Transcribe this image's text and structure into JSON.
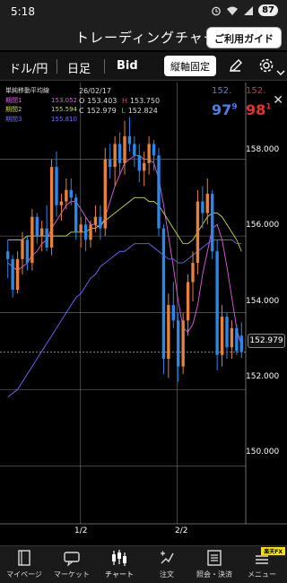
{
  "status": {
    "time": "5:18",
    "battery": "87"
  },
  "header": {
    "title": "トレーディングチャー",
    "guide_button": "ご利用ガイド"
  },
  "toolbar": {
    "pair": "ドル/円",
    "timeframe": "日足",
    "side": "Bid",
    "fix_axis": "縦軸固定",
    "icons": [
      "pencil-icon",
      "gear-icon",
      "chevron-down-icon"
    ]
  },
  "legend": {
    "title": "単純移動平均線",
    "periods": [
      {
        "label": "期間1",
        "value": "153.052",
        "color": "#e060e0"
      },
      {
        "label": "期間2",
        "value": "155.594",
        "color": "#c8d84a"
      },
      {
        "label": "期間3",
        "value": "155.810",
        "color": "#6a6aff"
      }
    ]
  },
  "ohlc": {
    "date": "26/02/17",
    "o_label": "O",
    "o": "153.403",
    "h_label": "H",
    "h": "153.750",
    "c_label": "C",
    "c": "152.979",
    "l_label": "L",
    "l": "152.824"
  },
  "quote": {
    "bid_head": "152.",
    "bid_main": "97",
    "bid_sup": "9",
    "ask_head": "152.",
    "ask_main": "98",
    "ask_sup": "1"
  },
  "axis": {
    "yticks": [
      "158.000",
      "156.000",
      "154.000",
      "152.000",
      "150.000"
    ],
    "current_price": "152.979",
    "xticks": [
      "1/2",
      "2/2"
    ]
  },
  "nav": [
    {
      "label": "マイページ",
      "icon": "book-icon"
    },
    {
      "label": "マーケット",
      "icon": "chat-icon"
    },
    {
      "label": "チャート",
      "icon": "candlestick-icon"
    },
    {
      "label": "注文",
      "icon": "order-icon"
    },
    {
      "label": "照会・決済",
      "icon": "list-icon"
    },
    {
      "label": "メニュー",
      "icon": "menu-icon"
    }
  ],
  "badge": "楽天FX",
  "chart_data": {
    "type": "candlestick",
    "pair": "USD/JPY",
    "ylim": [
      148.5,
      160.0
    ],
    "yticks": [
      158.0,
      156.0,
      154.0,
      152.0,
      150.0
    ],
    "xticks": [
      "1/2",
      "2/2"
    ],
    "candles": [
      [
        155.6,
        155.9,
        154.9,
        155.4
      ],
      [
        155.4,
        155.5,
        154.4,
        154.6
      ],
      [
        154.6,
        155.6,
        154.5,
        155.4
      ],
      [
        155.4,
        156.1,
        155.0,
        155.9
      ],
      [
        155.9,
        156.0,
        155.1,
        155.3
      ],
      [
        155.3,
        156.7,
        155.1,
        156.5
      ],
      [
        156.5,
        156.6,
        155.8,
        156.0
      ],
      [
        156.0,
        156.4,
        155.6,
        156.2
      ],
      [
        156.2,
        156.8,
        155.6,
        155.7
      ],
      [
        155.7,
        158.0,
        155.5,
        157.8
      ],
      [
        157.8,
        158.2,
        156.5,
        156.8
      ],
      [
        156.8,
        157.1,
        156.4,
        156.9
      ],
      [
        156.9,
        157.5,
        156.7,
        157.2
      ],
      [
        157.2,
        157.5,
        156.8,
        157.0
      ],
      [
        157.0,
        157.1,
        155.9,
        156.1
      ],
      [
        156.1,
        156.5,
        155.7,
        156.3
      ],
      [
        156.3,
        156.5,
        155.6,
        155.9
      ],
      [
        155.9,
        156.4,
        155.7,
        156.3
      ],
      [
        156.3,
        156.8,
        156.1,
        156.5
      ],
      [
        156.5,
        156.8,
        155.9,
        156.2
      ],
      [
        156.2,
        158.3,
        156.0,
        158.0
      ],
      [
        158.0,
        158.4,
        157.5,
        157.8
      ],
      [
        157.8,
        158.6,
        157.3,
        158.4
      ],
      [
        158.4,
        158.7,
        157.6,
        157.9
      ],
      [
        157.9,
        159.0,
        157.6,
        158.6
      ],
      [
        158.6,
        159.1,
        158.2,
        158.4
      ],
      [
        158.4,
        158.6,
        157.8,
        158.1
      ],
      [
        158.1,
        158.4,
        157.4,
        157.7
      ],
      [
        157.7,
        158.2,
        157.3,
        157.9
      ],
      [
        157.9,
        158.6,
        157.6,
        158.4
      ],
      [
        158.4,
        158.5,
        157.7,
        158.1
      ],
      [
        158.1,
        158.3,
        156.0,
        156.2
      ],
      [
        156.2,
        156.3,
        152.4,
        152.8
      ],
      [
        152.8,
        154.5,
        152.3,
        154.2
      ],
      [
        154.2,
        154.8,
        153.6,
        153.8
      ],
      [
        153.8,
        154.0,
        152.2,
        152.6
      ],
      [
        152.6,
        154.0,
        152.4,
        153.8
      ],
      [
        153.8,
        155.0,
        153.4,
        154.8
      ],
      [
        154.8,
        155.6,
        154.3,
        155.3
      ],
      [
        155.3,
        157.2,
        155.0,
        156.9
      ],
      [
        156.9,
        157.3,
        156.2,
        156.6
      ],
      [
        156.6,
        157.5,
        156.3,
        157.1
      ],
      [
        157.1,
        157.2,
        155.4,
        155.6
      ],
      [
        155.6,
        155.9,
        152.5,
        152.9
      ],
      [
        152.9,
        154.2,
        152.6,
        153.9
      ],
      [
        153.9,
        154.0,
        152.8,
        153.1
      ],
      [
        153.1,
        153.8,
        152.8,
        153.6
      ],
      [
        153.6,
        153.7,
        152.9,
        153.0
      ],
      [
        153.403,
        153.75,
        152.824,
        152.979
      ]
    ],
    "sma": [
      {
        "name": "期間1",
        "color": "#e060e0",
        "values": [
          155.3,
          155.2,
          155.1,
          155.2,
          155.3,
          155.5,
          155.6,
          155.8,
          155.9,
          156.2,
          156.4,
          156.6,
          156.8,
          156.9,
          156.9,
          156.7,
          156.5,
          156.3,
          156.3,
          156.2,
          156.5,
          156.9,
          157.3,
          157.6,
          157.9,
          158.0,
          158.1,
          158.1,
          158.0,
          158.0,
          157.9,
          157.5,
          156.8,
          156.0,
          155.2,
          154.3,
          153.6,
          153.5,
          153.7,
          154.2,
          155.0,
          155.6,
          156.2,
          156.3,
          155.9,
          155.2,
          154.4,
          153.6,
          153.1
        ]
      },
      {
        "name": "期間2",
        "color": "#c8d84a",
        "values": [
          155.9,
          155.9,
          155.9,
          155.9,
          156.0,
          156.0,
          156.0,
          156.0,
          156.0,
          156.0,
          156.0,
          156.0,
          156.0,
          156.1,
          156.1,
          156.1,
          156.1,
          156.2,
          156.2,
          156.3,
          156.4,
          156.5,
          156.6,
          156.7,
          156.8,
          156.9,
          157.0,
          157.0,
          157.0,
          156.9,
          156.9,
          156.8,
          156.6,
          156.4,
          156.2,
          156.0,
          155.8,
          155.8,
          155.9,
          156.1,
          156.3,
          156.5,
          156.6,
          156.6,
          156.5,
          156.3,
          156.1,
          155.9,
          155.6
        ]
      },
      {
        "name": "期間3",
        "color": "#6a6aff",
        "values": [
          151.8,
          151.9,
          152.0,
          152.2,
          152.4,
          152.6,
          152.8,
          153.0,
          153.2,
          153.4,
          153.6,
          153.8,
          154.0,
          154.2,
          154.4,
          154.5,
          154.7,
          154.9,
          155.0,
          155.2,
          155.3,
          155.4,
          155.5,
          155.6,
          155.6,
          155.7,
          155.8,
          155.8,
          155.8,
          155.8,
          155.7,
          155.6,
          155.5,
          155.4,
          155.4,
          155.3,
          155.3,
          155.4,
          155.5,
          155.6,
          155.7,
          155.8,
          155.9,
          155.9,
          155.9,
          155.9,
          155.9,
          155.8,
          155.8
        ]
      }
    ],
    "up_color": "#e8823a",
    "down_color": "#2b88e8"
  }
}
